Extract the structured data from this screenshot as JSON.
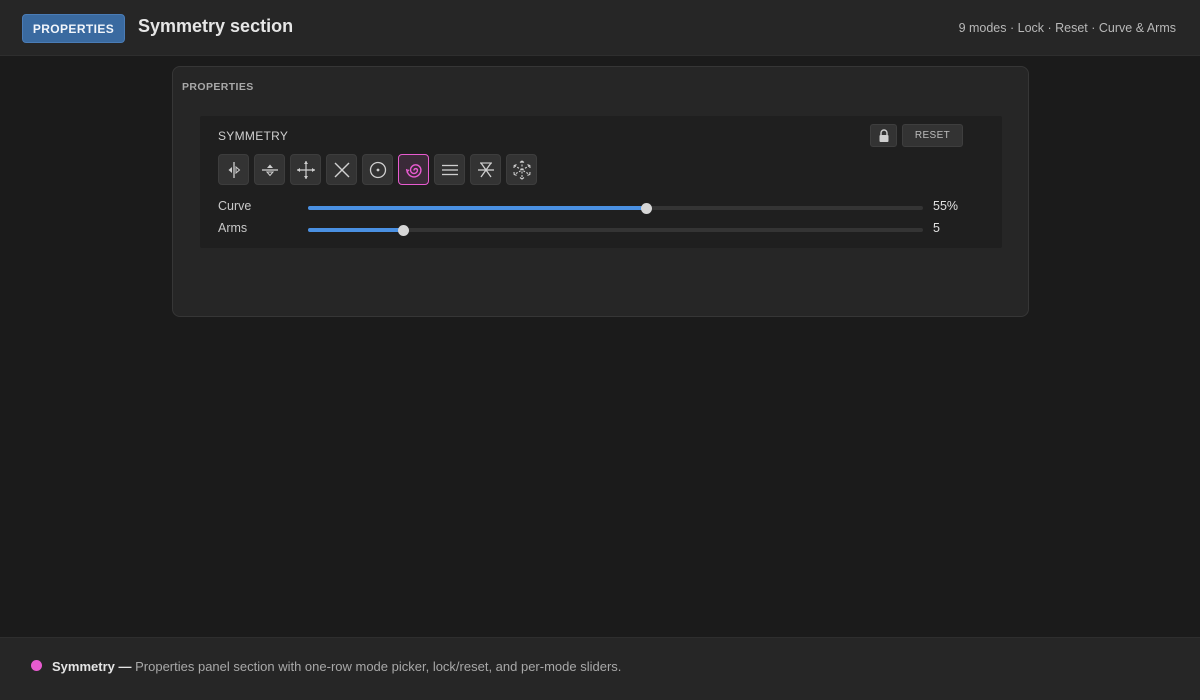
{
  "header": {
    "tag": "PROPERTIES",
    "title": "Symmetry section",
    "meta": "9 modes · Lock · Reset · Curve & Arms"
  },
  "panel": {
    "title": "PROPERTIES",
    "section": {
      "title": "SYMMETRY",
      "lock_icon": "lock-icon",
      "reset_label": "RESET",
      "modes": [
        {
          "icon": "vertical-mirror-icon",
          "active": false
        },
        {
          "icon": "horizontal-mirror-icon",
          "active": false
        },
        {
          "icon": "quad-mirror-icon",
          "active": false
        },
        {
          "icon": "diagonal-mirror-icon",
          "active": false
        },
        {
          "icon": "radial-icon",
          "active": false
        },
        {
          "icon": "spiral-icon",
          "active": true
        },
        {
          "icon": "parallel-lines-icon",
          "active": false
        },
        {
          "icon": "kaleidoscope-icon",
          "active": false
        },
        {
          "icon": "snowflake-icon",
          "active": false
        }
      ],
      "sliders": {
        "curve": {
          "label": "Curve",
          "value": "55%",
          "fraction": 0.55
        },
        "arms": {
          "label": "Arms",
          "value": "5",
          "fraction": 0.155
        }
      }
    }
  },
  "footer": {
    "title": "Symmetry —",
    "description": "Properties panel section with one-row mode picker, lock/reset, and per-mode sliders."
  },
  "colors": {
    "accent": "#4a90e2",
    "active_mode": "#e85bd0",
    "tag_bg": "#3a6aa0"
  }
}
